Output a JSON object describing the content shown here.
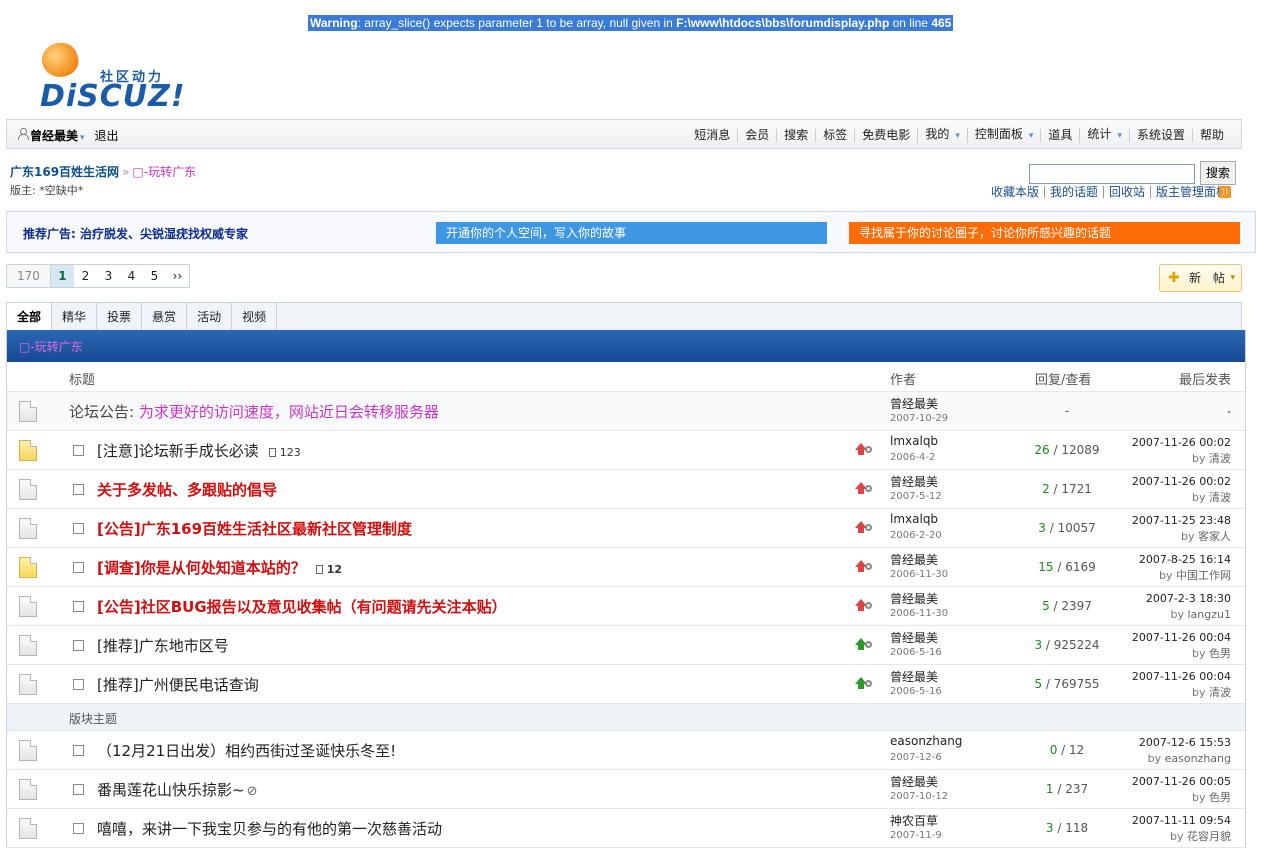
{
  "warning": {
    "label": "Warning",
    "text": ": array_slice() expects parameter 1 to be array, null given in ",
    "file": "F:\\www\\htdocs\\bbs\\forumdisplay.php",
    "online": " on line ",
    "line": "465"
  },
  "logo": {
    "cn": "社区动力",
    "en": "DiSCUZ!"
  },
  "userbar": {
    "username": "曾经最美",
    "logout": "退出"
  },
  "nav": [
    "短消息",
    "会员",
    "搜索",
    "标签",
    "免费电影",
    "我的",
    "控制面板",
    "道具",
    "统计",
    "系统设置",
    "帮助"
  ],
  "breadcrumb": {
    "home": "广东169百姓生活网",
    "sep": "»",
    "current": "□-玩转广东"
  },
  "moderator": "版主: *空缺中*",
  "search": {
    "button": "搜索",
    "value": ""
  },
  "toolinks": [
    "收藏本版",
    "我的话题",
    "回收站",
    "版主管理面板"
  ],
  "ads": {
    "ad1": "推荐广告: 治疗脱发、尖锐湿疣找权威专家",
    "ad2": "开通你的个人空间，写入你的故事",
    "ad3": "寻找属于你的讨论圈子，讨论你所感兴趣的话题"
  },
  "pager": {
    "total": "170",
    "pages": [
      "1",
      "2",
      "3",
      "4",
      "5",
      "››"
    ],
    "current": "1"
  },
  "newpost": "新 帖",
  "tabs": [
    "全部",
    "精华",
    "投票",
    "悬赏",
    "活动",
    "视频"
  ],
  "board": {
    "title": "□-玩转广东"
  },
  "columns": {
    "title": "标题",
    "author": "作者",
    "replies": "回复/查看",
    "last": "最后发表"
  },
  "announcement": {
    "prefix": "论坛公告: ",
    "text": "为求更好的访问速度，网站近日会转移服务器",
    "author": "曾经最美",
    "date": "2007-10-29",
    "counts": "-",
    "last": "-"
  },
  "threads": [
    {
      "title": "[注意]论坛新手成长必读",
      "pages": [
        "1",
        "2",
        "3"
      ],
      "style": "normal",
      "hot": true,
      "arrow": "red",
      "author": "lmxalqb",
      "date": "2006-4-2",
      "replies": "26",
      "views": "12089",
      "last_time": "2007-11-26 00:02",
      "last_user": "清波"
    },
    {
      "title": "关于多发帖、多跟贴的倡导",
      "pages": [],
      "style": "red",
      "hot": false,
      "arrow": "red",
      "author": "曾经最美",
      "date": "2007-5-12",
      "replies": "2",
      "views": "1721",
      "last_time": "2007-11-26 00:02",
      "last_user": "清波"
    },
    {
      "title": "[公告]广东169百姓生活社区最新社区管理制度",
      "pages": [],
      "style": "red",
      "hot": false,
      "arrow": "red",
      "author": "lmxalqb",
      "date": "2006-2-20",
      "replies": "3",
      "views": "10057",
      "last_time": "2007-11-25 23:48",
      "last_user": "客家人"
    },
    {
      "title": "[调查]你是从何处知道本站的？",
      "pages": [
        "1",
        "2"
      ],
      "style": "red",
      "hot": true,
      "arrow": "red",
      "author": "曾经最美",
      "date": "2006-11-30",
      "replies": "15",
      "views": "6169",
      "last_time": "2007-8-25 16:14",
      "last_user": "中国工作网"
    },
    {
      "title": "[公告]社区BUG报告以及意见收集帖（有问题请先关注本贴）",
      "pages": [],
      "style": "red",
      "hot": false,
      "arrow": "red",
      "author": "曾经最美",
      "date": "2006-11-30",
      "replies": "5",
      "views": "2397",
      "last_time": "2007-2-3 18:30",
      "last_user": "langzu1"
    },
    {
      "title": "[推荐]广东地市区号",
      "pages": [],
      "style": "normal",
      "hot": false,
      "arrow": "green",
      "author": "曾经最美",
      "date": "2006-5-16",
      "replies": "3",
      "views": "925224",
      "last_time": "2007-11-26 00:04",
      "last_user": "色男"
    },
    {
      "title": "[推荐]广州便民电话查询",
      "pages": [],
      "style": "normal",
      "hot": false,
      "arrow": "green",
      "author": "曾经最美",
      "date": "2006-5-16",
      "replies": "5",
      "views": "769755",
      "last_time": "2007-11-26 00:04",
      "last_user": "清波"
    }
  ],
  "section_label": "版块主题",
  "normal_threads": [
    {
      "title": "（12月21日出发）相约西街过圣诞快乐冬至!",
      "attach": false,
      "author": "easonzhang",
      "date": "2007-12-6",
      "replies": "0",
      "views": "12",
      "last_time": "2007-12-6 15:53",
      "last_user": "easonzhang"
    },
    {
      "title": "番禺莲花山快乐掠影~",
      "attach": true,
      "author": "曾经最美",
      "date": "2007-10-12",
      "replies": "1",
      "views": "237",
      "last_time": "2007-11-26 00:05",
      "last_user": "色男"
    },
    {
      "title": "嘻嘻，来讲一下我宝贝参与的有他的第一次慈善活动",
      "attach": false,
      "author": "神农百草",
      "date": "2007-11-9",
      "replies": "3",
      "views": "118",
      "last_time": "2007-11-11 09:54",
      "last_user": "花容月貌"
    }
  ],
  "by_label": "by "
}
